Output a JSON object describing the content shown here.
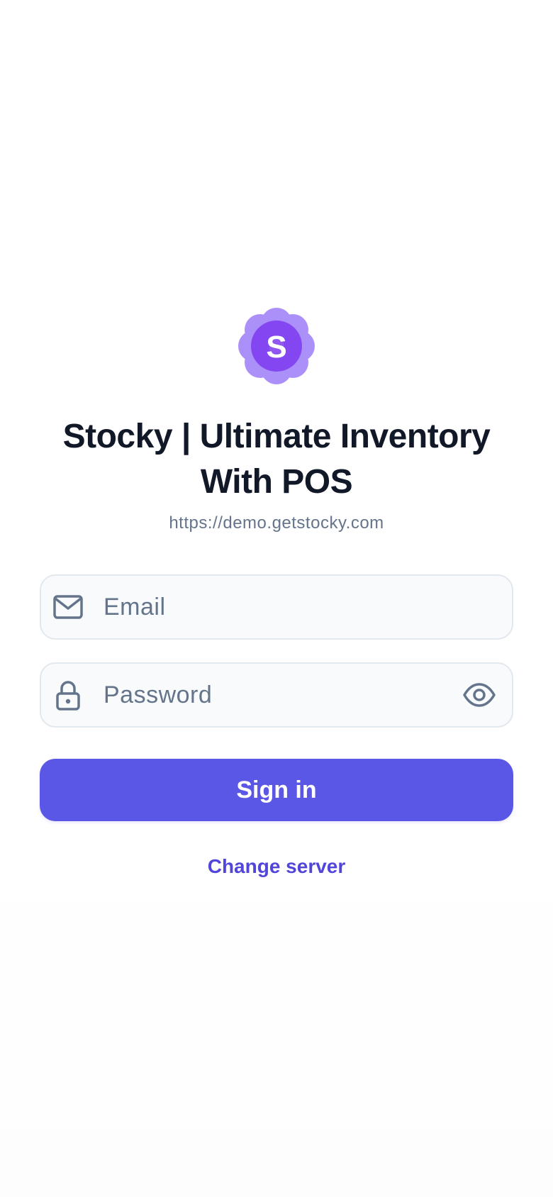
{
  "app": {
    "logo_letter": "S",
    "title": "Stocky | Ultimate Inventory With POS",
    "server_url": "https://demo.getstocky.com"
  },
  "form": {
    "email": {
      "placeholder": "Email",
      "value": "",
      "icon": "mail-icon"
    },
    "password": {
      "placeholder": "Password",
      "value": "",
      "icon": "lock-icon",
      "toggle_icon": "eye-icon"
    },
    "submit_label": "Sign in",
    "change_server_label": "Change server"
  },
  "colors": {
    "primary": "#5b57e6",
    "link": "#5146d9",
    "logo_light": "#a78bfa",
    "logo_dark": "#7c3aed",
    "title": "#111827",
    "muted": "#64748b",
    "field_bg": "#f8fafc",
    "field_border": "#e2e8f0"
  }
}
